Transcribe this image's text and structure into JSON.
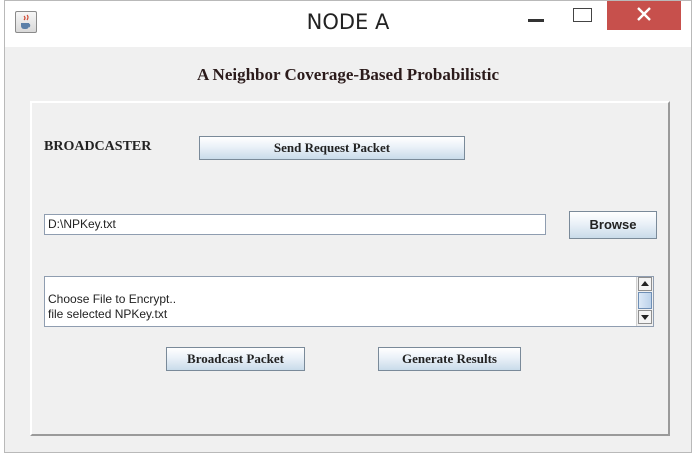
{
  "window": {
    "title": "NODE A",
    "heading": "A Neighbor Coverage-Based Probabilistic"
  },
  "broadcaster": {
    "label": "BROADCASTER",
    "send_request_label": "Send Request Packet"
  },
  "file": {
    "path_value": "D:\\NPKey.txt",
    "browse_label": "Browse"
  },
  "log": {
    "lines": [
      "",
      "Choose File to Encrypt..",
      "file selected NPKey.txt"
    ]
  },
  "actions": {
    "broadcast_label": "Broadcast Packet",
    "generate_label": "Generate Results"
  },
  "icons": {
    "app": "java-cup-icon",
    "minimize": "minimize-icon",
    "maximize": "maximize-icon",
    "close": "close-icon"
  },
  "colors": {
    "close_button": "#c7504c",
    "button_gradient_bottom": "#c9dbea"
  }
}
